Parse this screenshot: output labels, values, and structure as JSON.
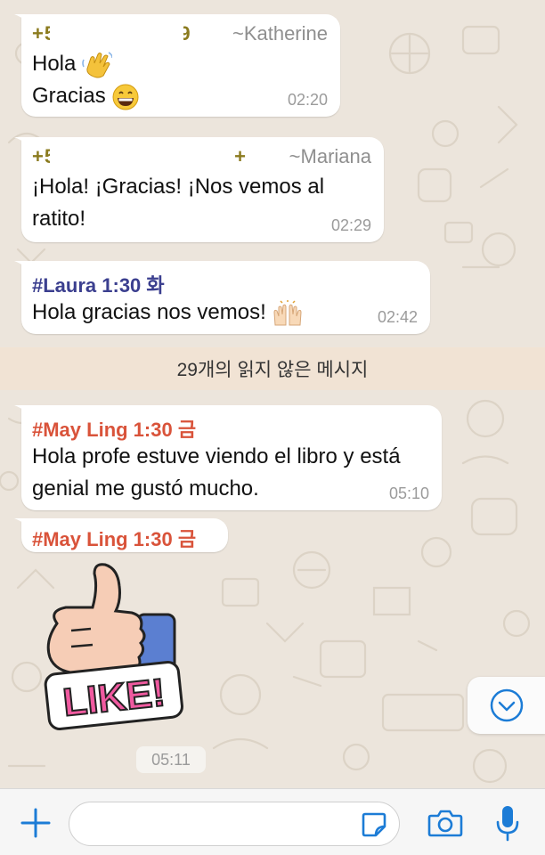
{
  "colors": {
    "accent": "#1c7cd6",
    "sender_phone": "#8b7b1f",
    "laura_tag": "#3b3f8f",
    "may_tag": "#d9533a",
    "unread_banner_bg": "#f1e3d4"
  },
  "messages": [
    {
      "phone": "+50",
      "phone_tail": "9",
      "alias": "~Katherine",
      "lines": [
        "Hola",
        "Gracias"
      ],
      "emojis": [
        "waving-hand-emoji",
        "grinning-face-emoji"
      ],
      "time": "02:20"
    },
    {
      "phone": "+5",
      "phone_tail": "+",
      "alias": "~Mariana",
      "text": "¡Hola! ¡Gracias! ¡Nos vemos al ratito!",
      "time": "02:29"
    },
    {
      "tag": "#Laura 1:30 화",
      "text": "Hola gracias nos vemos!",
      "emoji": "raising-hands-emoji",
      "time": "02:42"
    },
    {
      "tag": "#May Ling 1:30 금",
      "text": "Hola profe estuve viendo el libro y está genial me gustó mucho.",
      "time": "05:10"
    },
    {
      "tag": "#May Ling 1:30 금"
    }
  ],
  "unread_banner": "29개의 읽지 않은 메시지",
  "sticker": {
    "text": "LIKE!",
    "icon": "thumbs-up-like-sticker",
    "time": "05:11"
  },
  "composer": {
    "placeholder": "",
    "icons": [
      "plus-icon",
      "sticker-icon",
      "camera-icon",
      "microphone-icon"
    ]
  },
  "scroll_button_icon": "chevron-down-icon"
}
